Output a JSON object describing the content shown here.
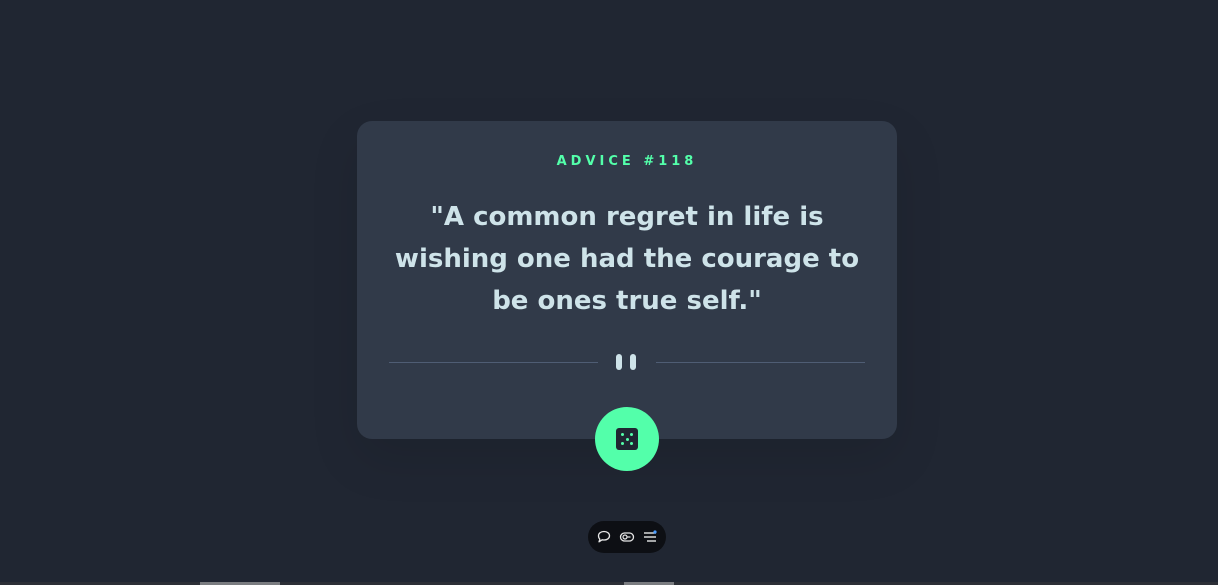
{
  "card": {
    "advice_label": "ADVICE #118",
    "quote": "\"A common regret in life is wishing one had the courage to be ones true self.\""
  },
  "divider": {
    "icon": "pause-icon"
  },
  "actions": {
    "dice_icon": "dice-icon"
  },
  "toolbar": {
    "icons": [
      "comment-icon",
      "toggle-icon",
      "menu-icon"
    ]
  },
  "colors": {
    "background": "#202632",
    "card": "#313a49",
    "accent": "#53ffaa",
    "text": "#cee3e9",
    "divider": "#4f5d74"
  }
}
